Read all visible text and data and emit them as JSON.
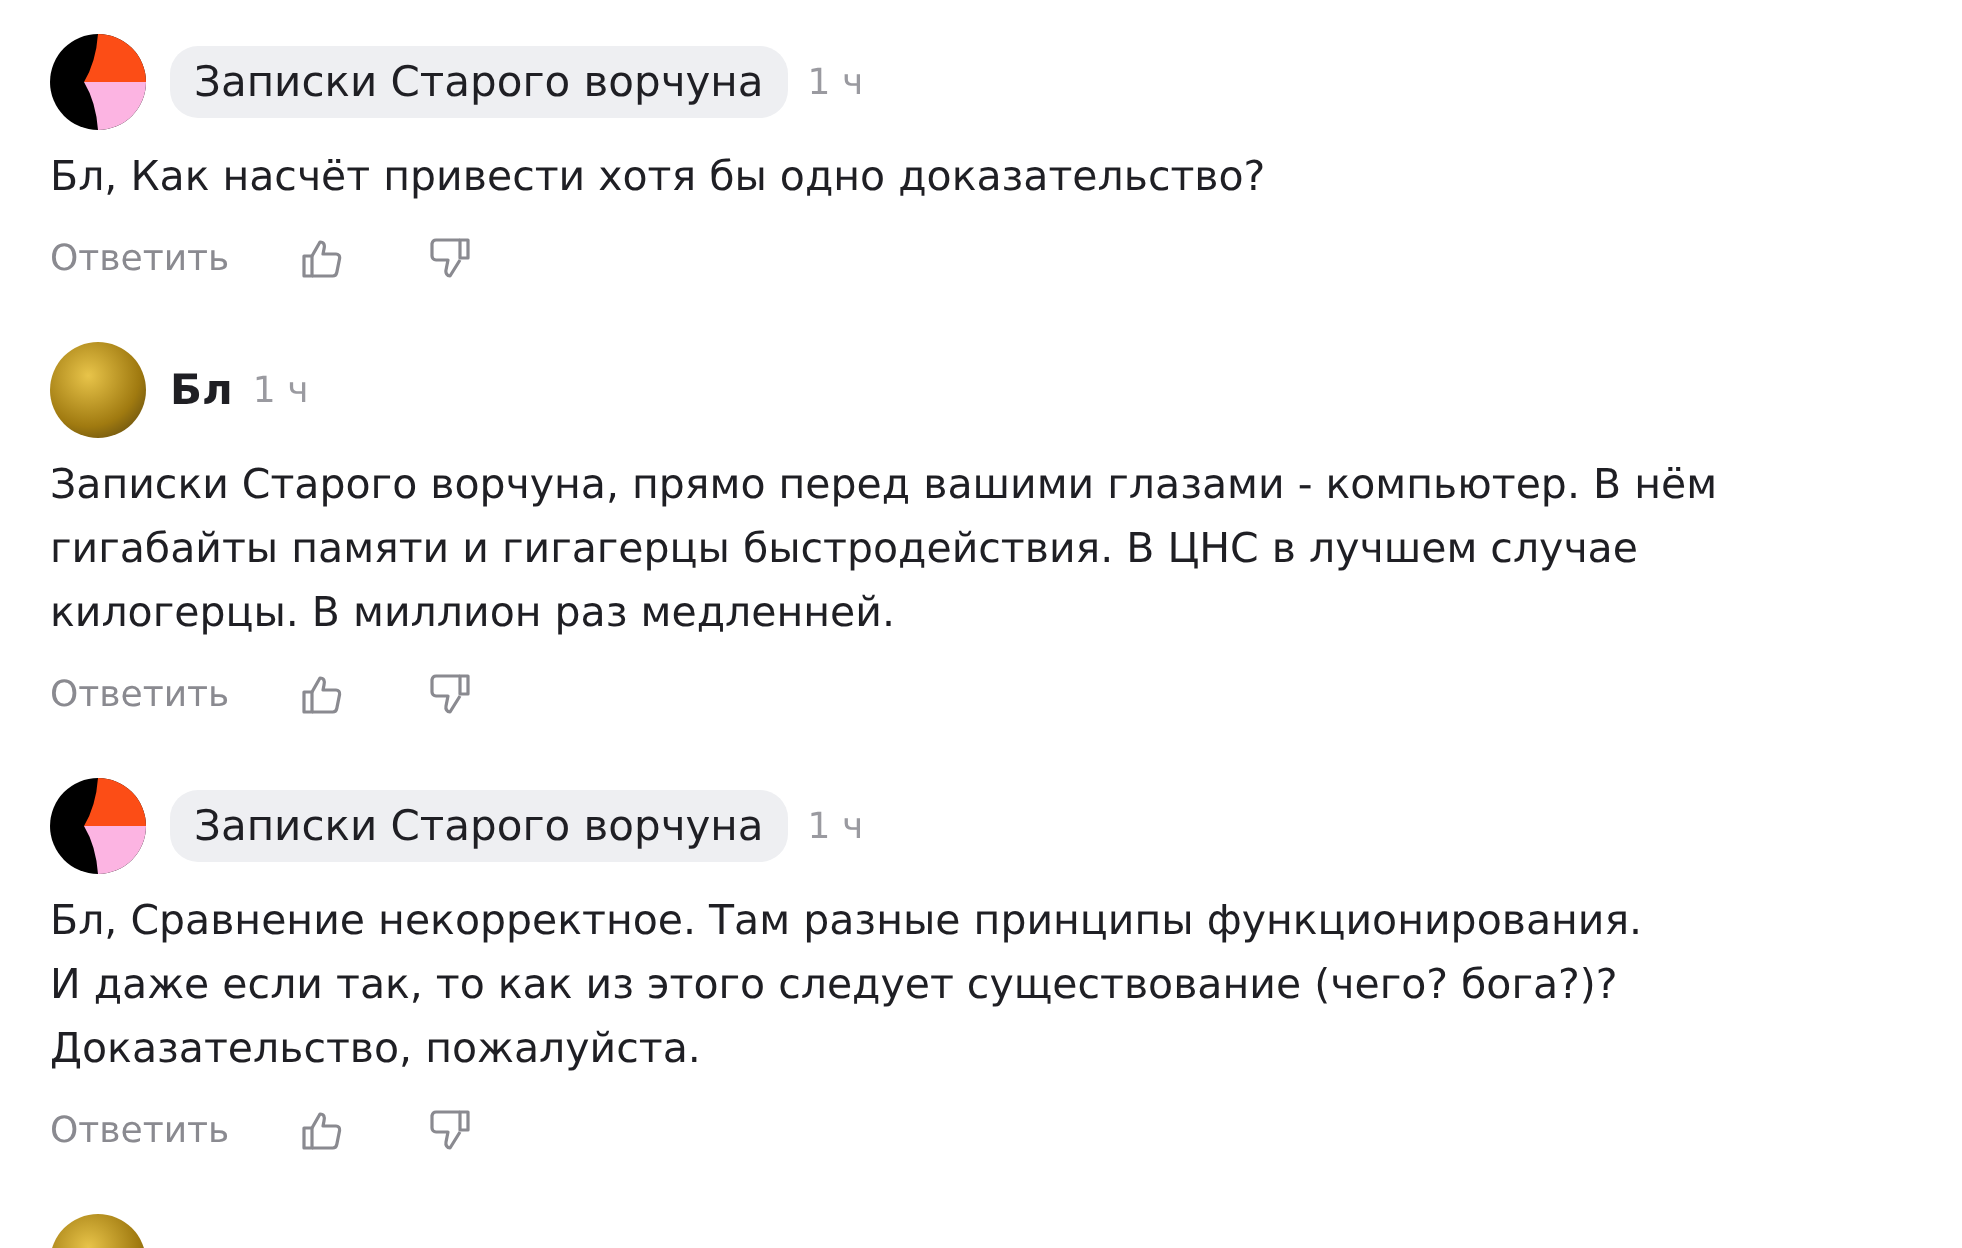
{
  "comments": [
    {
      "kind": "logo",
      "author": "Записки Старого ворчуна",
      "author_highlighted": true,
      "time": "1 ч",
      "text": "Бл, Как насчёт привести хотя бы одно доказательство?",
      "reply": "Ответить"
    },
    {
      "kind": "photo",
      "author": "Бл",
      "author_highlighted": false,
      "time": "1 ч",
      "text": "Записки Старого ворчуна, прямо перед вашими глазами - компьютер. В нём\nгигабайты памяти и гигагерцы быстродействия. В ЦНС в лучшем случае\nкилогерцы. В миллион раз медленней.",
      "reply": "Ответить"
    },
    {
      "kind": "logo",
      "author": "Записки Старого ворчуна",
      "author_highlighted": true,
      "time": "1 ч",
      "text": "Бл, Сравнение некорректное. Там разные принципы функционирования.\nИ даже если так, то как из этого следует существование (чего? бога?)?\nДоказательство, пожалуйста.",
      "reply": "Ответить"
    },
    {
      "kind": "photo"
    }
  ]
}
